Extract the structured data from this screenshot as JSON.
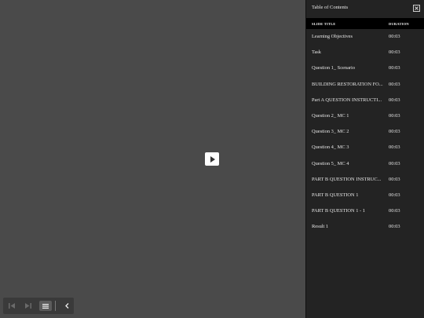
{
  "toc": {
    "title": "Table of Contents",
    "col_title": "SLIDE TITLE",
    "col_duration": "DURATION",
    "rows": [
      {
        "title": "Learning Objectives",
        "duration": "00:03"
      },
      {
        "title": "Task",
        "duration": "00:03"
      },
      {
        "title": "Question 1_ Scenario",
        "duration": "00:03"
      },
      {
        "title": "BUILDING RESTORATION FO...",
        "duration": "00:03"
      },
      {
        "title": "Part A QUESTION INSTRUCTI...",
        "duration": "00:03"
      },
      {
        "title": "Question 2_ MC 1",
        "duration": "00:03"
      },
      {
        "title": "Question 3_ MC 2",
        "duration": "00:03"
      },
      {
        "title": "Question 4_ MC 3",
        "duration": "00:03"
      },
      {
        "title": "Question 5_ MC 4",
        "duration": "00:03"
      },
      {
        "title": "PART B QUESTION INSTRUC...",
        "duration": "00:03"
      },
      {
        "title": "PART B QUESTION 1",
        "duration": "00:03"
      },
      {
        "title": "PART B QUESTION 1 - 1",
        "duration": "00:03"
      },
      {
        "title": "Result 1",
        "duration": "00:03"
      }
    ]
  },
  "icons": {
    "play": "play-icon",
    "close": "close-icon",
    "prev": "previous-slide-icon",
    "next": "next-slide-icon",
    "menu": "menu-icon",
    "collapse": "chevron-left-icon"
  },
  "colors": {
    "stage_bg": "#4a4a4a",
    "panel_bg": "#232323",
    "header_bg": "#000000",
    "text": "#e6e6e6"
  }
}
